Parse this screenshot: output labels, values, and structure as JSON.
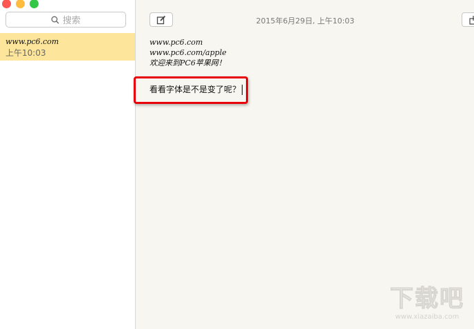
{
  "window": {
    "traffic_lights": {
      "close": "#fc5753",
      "minimize": "#fdbc40",
      "zoom": "#33c748"
    }
  },
  "sidebar": {
    "search_placeholder": "搜索",
    "notes": [
      {
        "title": "www.pc6.com",
        "time": "上午10:03",
        "highlight": "#fde59b"
      }
    ]
  },
  "main": {
    "date": "2015年6月29日, 上午10:03",
    "lines": [
      "www.pc6.com",
      "www.pc6.com/apple",
      "欢迎来到PC6苹果网！"
    ],
    "highlighted_line": "看看字体是不是变了呢？"
  },
  "watermark": {
    "text": "下载吧",
    "url": "www.xiazaiba.com"
  }
}
